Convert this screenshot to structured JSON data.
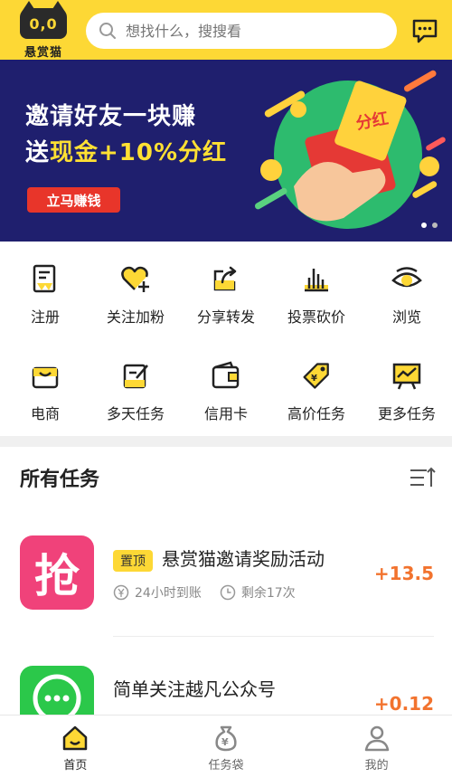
{
  "header": {
    "logo_face": "0,0",
    "logo_text": "悬赏猫",
    "search_placeholder": "想找什么，搜搜看"
  },
  "banner": {
    "title": "邀请好友一块赚",
    "subtitle_prefix": "送",
    "subtitle_highlight": "现金+10%分红",
    "button_label": "立马赚钱",
    "ticket_text": "分红",
    "slide_count": 2,
    "active_slide": 1
  },
  "grid": {
    "row1": [
      {
        "label": "注册",
        "icon": "register-icon"
      },
      {
        "label": "关注加粉",
        "icon": "heart-plus-icon"
      },
      {
        "label": "分享转发",
        "icon": "share-icon"
      },
      {
        "label": "投票砍价",
        "icon": "vote-chart-icon"
      },
      {
        "label": "浏览",
        "icon": "eye-icon"
      }
    ],
    "row2": [
      {
        "label": "电商",
        "icon": "shopping-bag-icon"
      },
      {
        "label": "多天任务",
        "icon": "edit-note-icon"
      },
      {
        "label": "信用卡",
        "icon": "wallet-icon"
      },
      {
        "label": "高价任务",
        "icon": "price-tag-icon"
      },
      {
        "label": "更多任务",
        "icon": "presentation-chart-icon"
      }
    ]
  },
  "section": {
    "title": "所有任务"
  },
  "tasks": [
    {
      "icon_char": "抢",
      "tag": "置顶",
      "name": "悬赏猫邀请奖励活动",
      "meta_payout": "24小时到账",
      "meta_remaining": "剩余17次",
      "reward": "+13.5"
    },
    {
      "name": "简单关注越凡公众号",
      "reward": "+0.12"
    }
  ],
  "nav": [
    {
      "label": "首页",
      "icon": "home-icon",
      "active": true
    },
    {
      "label": "任务袋",
      "icon": "money-bag-icon",
      "active": false
    },
    {
      "label": "我的",
      "icon": "profile-icon",
      "active": false
    }
  ],
  "colors": {
    "brand_yellow": "#fdd835",
    "banner_bg": "#1f1f6e",
    "reward_orange": "#f2732e",
    "button_red": "#e8352a"
  }
}
